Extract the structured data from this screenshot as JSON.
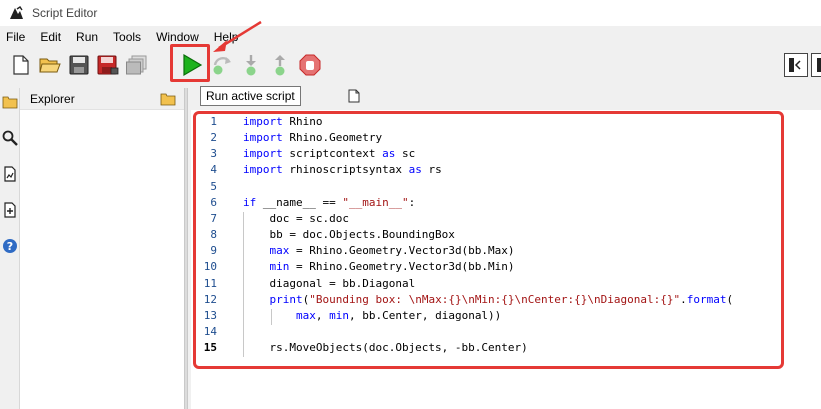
{
  "window": {
    "title": "Script Editor"
  },
  "menu": [
    "File",
    "Edit",
    "Run",
    "Tools",
    "Window",
    "Help"
  ],
  "toolbar": {
    "tooltip": "Run active script",
    "buttons": [
      "new-file",
      "open-folder",
      "save",
      "save-as",
      "save-all",
      "run",
      "debug",
      "step-into",
      "step-out",
      "stop"
    ]
  },
  "explorer": {
    "title": "Explorer"
  },
  "editor": {
    "lines": [
      {
        "num": "1",
        "tokens": [
          [
            "kw",
            "import"
          ],
          [
            "t",
            " Rhino"
          ]
        ]
      },
      {
        "num": "2",
        "tokens": [
          [
            "kw",
            "import"
          ],
          [
            "t",
            " Rhino.Geometry"
          ]
        ]
      },
      {
        "num": "3",
        "tokens": [
          [
            "kw",
            "import"
          ],
          [
            "t",
            " scriptcontext "
          ],
          [
            "kw",
            "as"
          ],
          [
            "t",
            " sc"
          ]
        ]
      },
      {
        "num": "4",
        "tokens": [
          [
            "kw",
            "import"
          ],
          [
            "t",
            " rhinoscriptsyntax "
          ],
          [
            "kw",
            "as"
          ],
          [
            "t",
            " rs"
          ]
        ]
      },
      {
        "num": "5",
        "tokens": []
      },
      {
        "num": "6",
        "tokens": [
          [
            "kw",
            "if"
          ],
          [
            "t",
            " __name__ == "
          ],
          [
            "str",
            "\"__main__\""
          ],
          [
            "t",
            ":"
          ]
        ]
      },
      {
        "num": "7",
        "tokens": [
          [
            "t",
            "    doc = sc.doc"
          ]
        ]
      },
      {
        "num": "8",
        "tokens": [
          [
            "t",
            "    bb = doc.Objects.BoundingBox"
          ]
        ]
      },
      {
        "num": "9",
        "tokens": [
          [
            "t",
            "    "
          ],
          [
            "kw",
            "max"
          ],
          [
            "t",
            " = Rhino.Geometry.Vector3d(bb.Max)"
          ]
        ]
      },
      {
        "num": "10",
        "tokens": [
          [
            "t",
            "    "
          ],
          [
            "kw",
            "min"
          ],
          [
            "t",
            " = Rhino.Geometry.Vector3d(bb.Min)"
          ]
        ]
      },
      {
        "num": "11",
        "tokens": [
          [
            "t",
            "    diagonal = bb.Diagonal"
          ]
        ]
      },
      {
        "num": "12",
        "tokens": [
          [
            "t",
            "    "
          ],
          [
            "kw",
            "print"
          ],
          [
            "t",
            "("
          ],
          [
            "str",
            "\"Bounding box: \\nMax:{}\\nMin:{}\\nCenter:{}\\nDiagonal:{}\""
          ],
          [
            "t",
            "."
          ],
          [
            "kw",
            "format"
          ],
          [
            "t",
            "("
          ]
        ]
      },
      {
        "num": "13",
        "tokens": [
          [
            "t",
            "        "
          ],
          [
            "kw",
            "max"
          ],
          [
            "t",
            ", "
          ],
          [
            "kw",
            "min"
          ],
          [
            "t",
            ", bb.Center, diagonal))"
          ]
        ]
      },
      {
        "num": "14",
        "tokens": []
      },
      {
        "num": "15",
        "tokens": [
          [
            "t",
            "    rs.MoveObjects(doc.Objects, -bb.Center)"
          ]
        ]
      }
    ],
    "current_line": "15"
  },
  "colors": {
    "accent_red": "#e53935",
    "run_green": "#1db21d",
    "keyword": "#0000ff",
    "string": "#a31515"
  }
}
